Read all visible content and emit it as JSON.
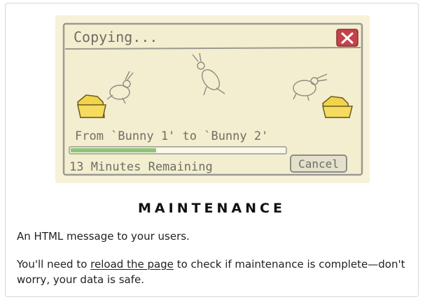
{
  "page": {
    "title": "MAINTENANCE",
    "message": "An HTML message to your users.",
    "reload_prefix": "You'll need to ",
    "reload_link": "reload the page",
    "reload_suffix": " to check if maintenance is complete—don't worry, your data is safe."
  },
  "illustration": {
    "dialog_title": "Copying...",
    "from_text": "From `Bunny 1' to `Bunny 2'",
    "remaining_text": "13 Minutes Remaining",
    "cancel_label": "Cancel",
    "progress_fraction": 0.4,
    "icons": [
      "close-icon",
      "folder-icon",
      "bunny-icon"
    ],
    "colors": {
      "paper": "#f6f1d8",
      "close_red": "#c4424a",
      "folder_yellow": "#f2d44a",
      "progress_green": "#8fc47a"
    }
  }
}
